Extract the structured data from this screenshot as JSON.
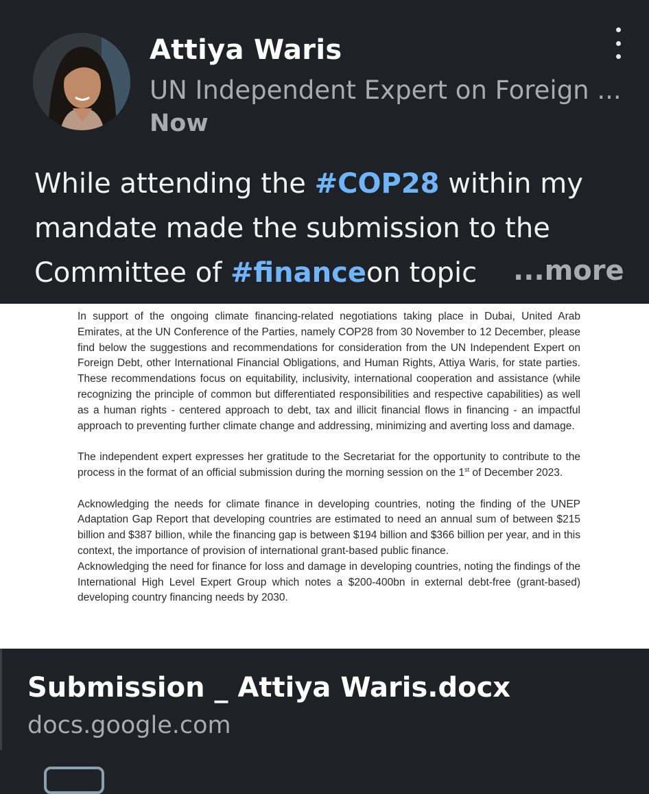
{
  "post": {
    "author_name": "Attiya Waris",
    "author_title": "UN Independent Expert on Foreign ...",
    "time": "Now",
    "text_lines": [
      [
        "While attending the ",
        "#COP28",
        " within my"
      ],
      [
        "mandate made the submission to the"
      ],
      [
        "Committee of ",
        "#finance",
        " on topic"
      ]
    ],
    "more_label": "...more"
  },
  "document_preview": {
    "para1": "In support of the ongoing climate financing-related negotiations taking place in Dubai, United Arab Emirates, at the UN Conference of the Parties, namely COP28 from 30 November to 12 December, please find below the suggestions and recommendations for consideration from the UN Independent Expert on Foreign Debt, other International Financial Obligations, and Human Rights, Attiya Waris, for state parties. These recommendations focus on equitability, inclusivity, international cooperation and assistance (while recognizing the principle of common but differentiated responsibilities and respective capabilities) as well as a human rights - centered approach to debt, tax and illicit financial flows in financing - an impactful approach to preventing further climate change and addressing, minimizing and averting loss and damage.",
    "para2_before": "The independent expert expresses her gratitude to the Secretariat for the opportunity to contribute to the process in the format of an official submission during the morning session on the 1",
    "para2_sup": "st",
    "para2_after": " of December 2023.",
    "para3": "Acknowledging the needs for climate finance in developing countries, noting the finding of the UNEP Adaptation Gap Report that developing countries are estimated to need an annual sum of between $215 billion and $387 billion, while the financing gap is between $194 billion and $366 billion per year, and in this context, the importance of provision of international grant-based public finance.",
    "para4": "Acknowledging the need for finance for loss and damage in developing countries, noting the findings of the International High Level Expert Group which notes a $200-400bn in external debt-free (grant-based) developing country financing needs by 2030."
  },
  "link_card": {
    "title": "Submission _ Attiya Waris.docx",
    "domain": "docs.google.com"
  },
  "colors": {
    "background": "#1e2227",
    "hashtag": "#70b5f9",
    "muted_text": "#a8acb1"
  },
  "icons": {
    "menu": "vertical-ellipsis-icon"
  }
}
